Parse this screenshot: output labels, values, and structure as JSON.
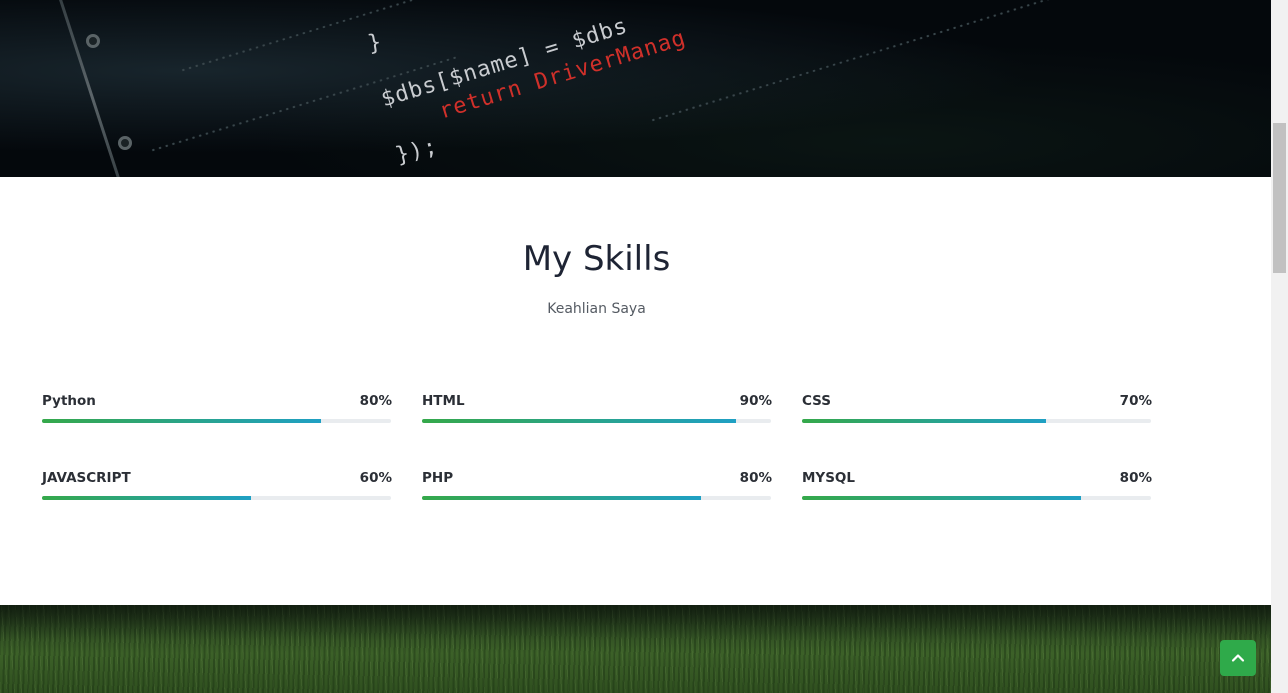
{
  "hero_code": {
    "lines": [
      "}",
      "$dbs[$name] = $dbs",
      "return DriverManag",
      "});"
    ]
  },
  "skills": {
    "title": "My Skills",
    "subtitle": "Keahlian Saya",
    "items": [
      {
        "name": "Python",
        "percent_label": "80%",
        "level": 0.8
      },
      {
        "name": "HTML",
        "percent_label": "90%",
        "level": 0.9
      },
      {
        "name": "CSS",
        "percent_label": "70%",
        "level": 0.7
      },
      {
        "name": "JAVASCRIPT",
        "percent_label": "60%",
        "level": 0.6
      },
      {
        "name": "PHP",
        "percent_label": "80%",
        "level": 0.8
      },
      {
        "name": "MYSQL",
        "percent_label": "80%",
        "level": 0.8
      }
    ],
    "bar_gradient_start": "#35a84a",
    "bar_gradient_end": "#1fa0c4"
  },
  "scroll_top_button": {
    "icon": "chevron-up-icon",
    "color": "#2faa4a"
  }
}
